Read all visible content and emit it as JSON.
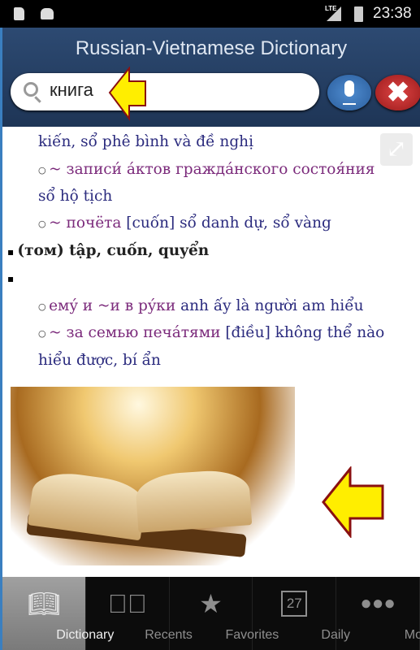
{
  "status_bar": {
    "time": "23:38",
    "network": "LTE"
  },
  "header": {
    "title": "Russian-Vietnamese Dictionary",
    "search": {
      "value": "книга"
    }
  },
  "content": {
    "lines": [
      {
        "vi": "kiến, sổ phê bình và đề nghị"
      },
      {
        "ru": "~ записи́ áктов граждáнского состоя́ния"
      },
      {
        "vi": "sổ hộ tịch"
      },
      {
        "ru": "~ почёта",
        "vi": "[cuốn] sổ danh dự, sổ vàng"
      },
      {
        "main": "(том) tập, cuốn, quyển"
      },
      {
        "ru": "емý и ~и в рýки",
        "vi": "anh ấy là người am hiểu"
      },
      {
        "ru": "~ за семью печáтями",
        "vi": "[điều] không thể nào"
      },
      {
        "vi": "hiểu được, bí ẩn"
      }
    ]
  },
  "tabs": [
    {
      "label": "Dictionary",
      "icon": "book-icon",
      "active": true
    },
    {
      "label": "Recents",
      "icon": "clock-check-icon"
    },
    {
      "label": "Favorites",
      "icon": "star-icon"
    },
    {
      "label": "Daily",
      "icon": "calendar-icon",
      "day": "27"
    },
    {
      "label": "More",
      "icon": "more-icon"
    }
  ],
  "colors": {
    "header": "#253f63",
    "russian": "#7b2a7b",
    "vietnamese": "#2b2b7e",
    "highlight_arrow": "#ffee00"
  }
}
